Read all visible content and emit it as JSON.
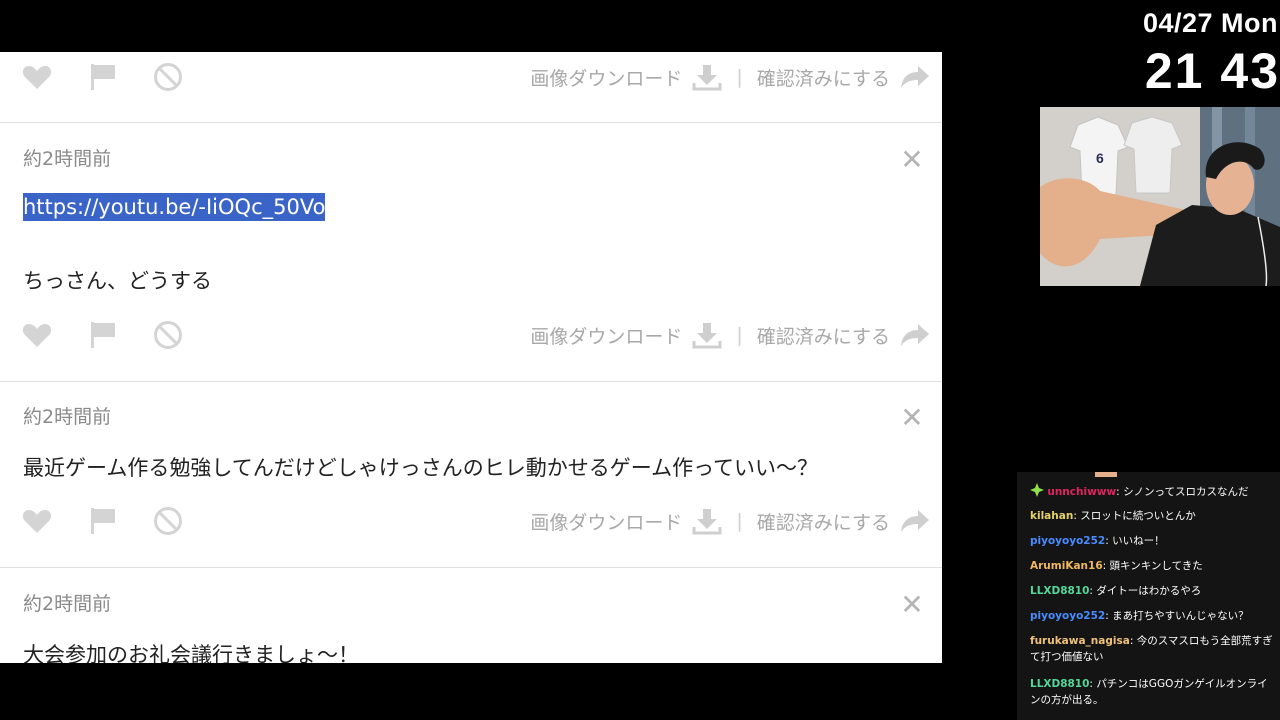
{
  "overlay": {
    "date": "04/27 Mon",
    "time": "21 43"
  },
  "actions": {
    "download_label": "画像ダウンロード",
    "separator": "|",
    "confirm_label": "確認済みにする",
    "close_glyph": "✕"
  },
  "messages": [
    {
      "time": "約2時間前",
      "link": "https://youtu.be/-IiOQc_50Vo",
      "text": "ちっさん、どうする"
    },
    {
      "time": "約2時間前",
      "text": "最近ゲーム作る勉強してんだけどしゃけっさんのヒレ動かせるゲーム作っていい〜？"
    },
    {
      "time": "約2時間前",
      "text": "大会参加のお礼会議行きましょ〜！"
    }
  ],
  "chat": {
    "badge_icon": "sparkle-icon",
    "lines": [
      {
        "user": "unnchiwww",
        "color": "#e0245e",
        "sep": ": ",
        "msg": "シノンってスロカスなんだ"
      },
      {
        "user": "kilahan",
        "color": "#e6d26b",
        "sep": ": ",
        "msg": "スロットに続ついとんか"
      },
      {
        "user": "piyoyoyo252",
        "color": "#4a8cff",
        "sep": ": ",
        "msg": "いいねー！"
      },
      {
        "user": "ArumiKan16",
        "color": "#f0b860",
        "sep": ": ",
        "msg": "頭キンキンしてきた"
      },
      {
        "user": "LLXD8810",
        "color": "#56d69a",
        "sep": ": ",
        "msg": "ダイトーはわかるやろ"
      },
      {
        "user": "piyoyoyo252",
        "color": "#4a8cff",
        "sep": ": ",
        "msg": "まあ打ちやすいんじゃない？"
      },
      {
        "user": "furukawa_nagisa",
        "color": "#f0c27a",
        "sep": ": ",
        "msg": "今のスマスロもう全部荒すぎて打つ価値ない"
      },
      {
        "user": "LLXD8810",
        "color": "#56d69a",
        "sep": ": ",
        "msg": "パチンコはGGOガンゲイルオンラインの方が出る。"
      }
    ]
  },
  "colors": {
    "link_highlight": "#3b64c8",
    "icon_gray": "#cfcfcf",
    "chat_bg": "#141414"
  }
}
